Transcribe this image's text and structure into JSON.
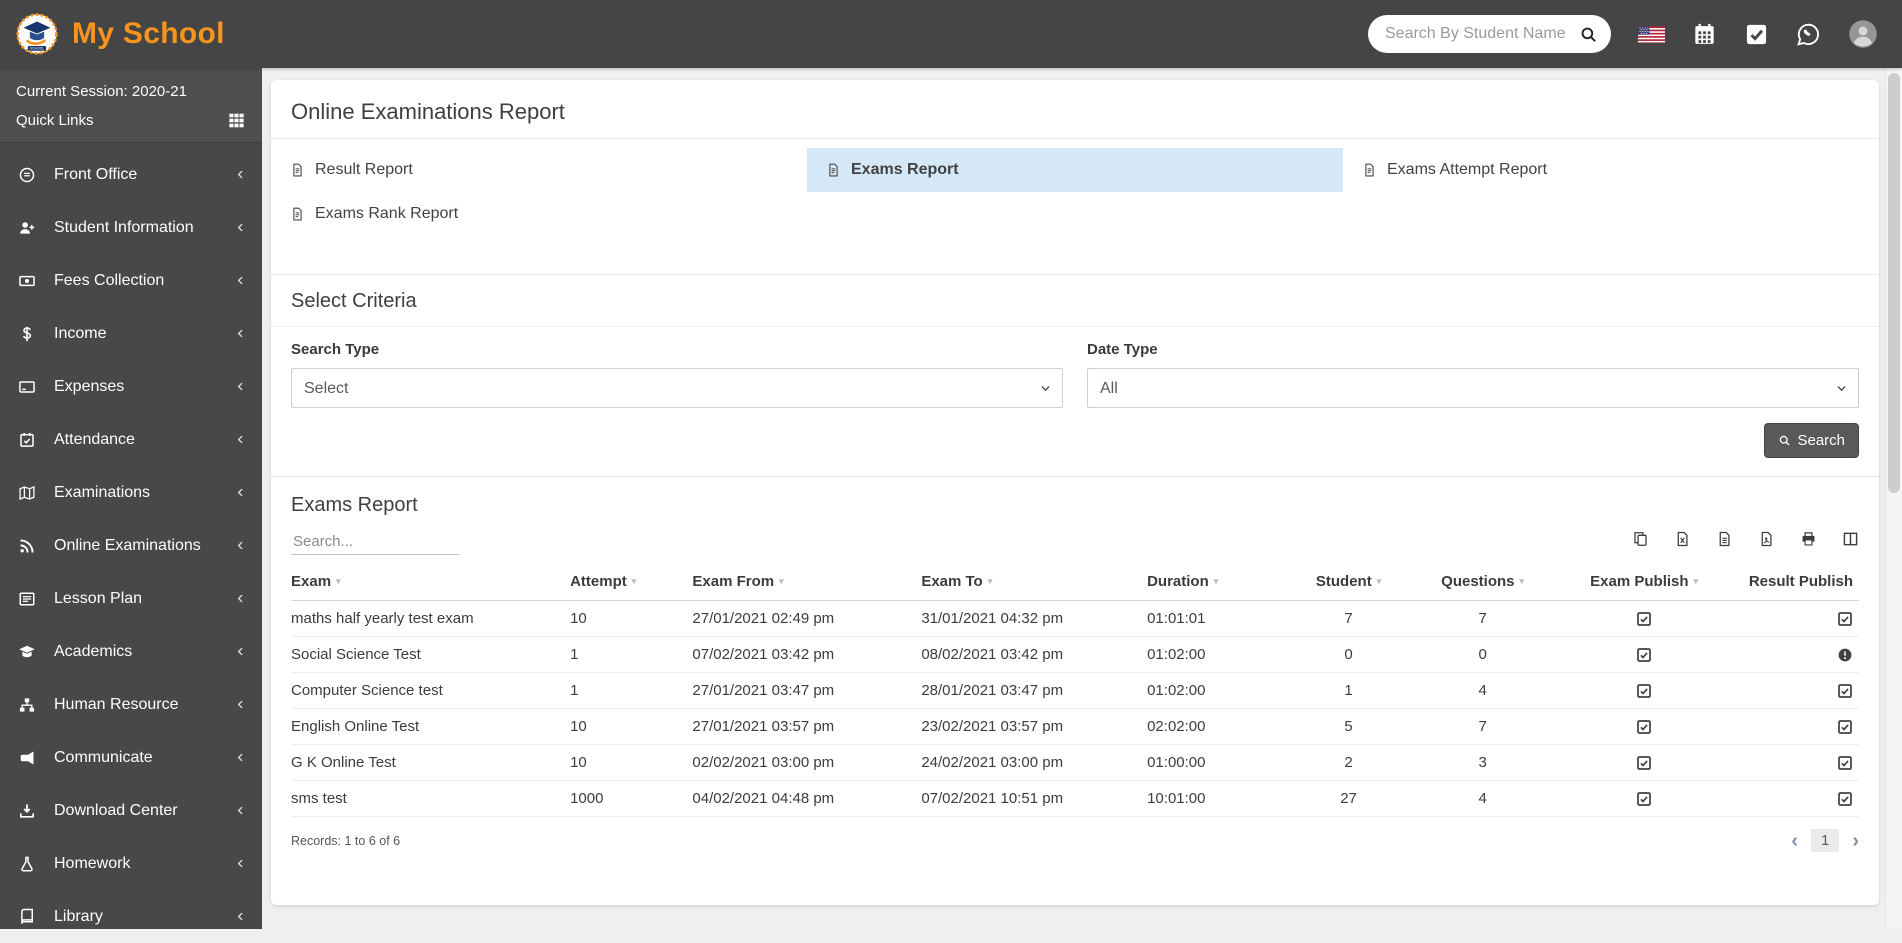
{
  "navbar": {
    "brand": "My School",
    "search_placeholder": "Search By Student Name",
    "icons": [
      "us-flag-icon",
      "calendar-icon",
      "tasks-icon",
      "whatsapp-icon",
      "user-avatar-icon"
    ]
  },
  "sidebar": {
    "session_label": "Current Session: 2020-21",
    "quick_links_label": "Quick Links",
    "items": [
      {
        "label": "Front Office",
        "icon": "front-office-icon"
      },
      {
        "label": "Student Information",
        "icon": "student-information-icon"
      },
      {
        "label": "Fees Collection",
        "icon": "fees-collection-icon"
      },
      {
        "label": "Income",
        "icon": "income-icon"
      },
      {
        "label": "Expenses",
        "icon": "expenses-icon"
      },
      {
        "label": "Attendance",
        "icon": "attendance-icon"
      },
      {
        "label": "Examinations",
        "icon": "examinations-icon"
      },
      {
        "label": "Online Examinations",
        "icon": "online-examinations-icon"
      },
      {
        "label": "Lesson Plan",
        "icon": "lesson-plan-icon"
      },
      {
        "label": "Academics",
        "icon": "academics-icon"
      },
      {
        "label": "Human Resource",
        "icon": "human-resource-icon"
      },
      {
        "label": "Communicate",
        "icon": "communicate-icon"
      },
      {
        "label": "Download Center",
        "icon": "download-center-icon"
      },
      {
        "label": "Homework",
        "icon": "homework-icon"
      },
      {
        "label": "Library",
        "icon": "library-icon"
      }
    ]
  },
  "main": {
    "page_title": "Online Examinations Report",
    "report_links": [
      {
        "label": "Result Report",
        "active": false
      },
      {
        "label": "Exams Report",
        "active": true
      },
      {
        "label": "Exams Attempt Report",
        "active": false
      },
      {
        "label": "Exams Rank Report",
        "active": false
      }
    ],
    "criteria": {
      "heading": "Select Criteria",
      "search_type_label": "Search Type",
      "search_type_value": "Select",
      "date_type_label": "Date Type",
      "date_type_value": "All",
      "search_button": "Search"
    },
    "exams_report": {
      "heading": "Exams Report",
      "search_placeholder": "Search...",
      "export_icons": [
        "copy-icon",
        "excel-icon",
        "file-lines-icon",
        "pdf-icon",
        "print-icon",
        "columns-icon"
      ],
      "columns": [
        "Exam",
        "Attempt",
        "Exam From",
        "Exam To",
        "Duration",
        "Student",
        "Questions",
        "Exam Publish",
        "Result Publish"
      ],
      "rows": [
        {
          "exam": "maths half yearly test exam",
          "attempt": "10",
          "exam_from": "27/01/2021 02:49 pm",
          "exam_to": "31/01/2021 04:32 pm",
          "duration": "01:01:01",
          "student": "7",
          "questions": "7",
          "exam_publish": "checked",
          "result_publish": "checked"
        },
        {
          "exam": "Social Science Test",
          "attempt": "1",
          "exam_from": "07/02/2021 03:42 pm",
          "exam_to": "08/02/2021 03:42 pm",
          "duration": "01:02:00",
          "student": "0",
          "questions": "0",
          "exam_publish": "checked",
          "result_publish": "alert"
        },
        {
          "exam": "Computer Science test",
          "attempt": "1",
          "exam_from": "27/01/2021 03:47 pm",
          "exam_to": "28/01/2021 03:47 pm",
          "duration": "01:02:00",
          "student": "1",
          "questions": "4",
          "exam_publish": "checked",
          "result_publish": "checked"
        },
        {
          "exam": "English Online Test",
          "attempt": "10",
          "exam_from": "27/01/2021 03:57 pm",
          "exam_to": "23/02/2021 03:57 pm",
          "duration": "02:02:00",
          "student": "5",
          "questions": "7",
          "exam_publish": "checked",
          "result_publish": "checked"
        },
        {
          "exam": "G K Online Test",
          "attempt": "10",
          "exam_from": "02/02/2021 03:00 pm",
          "exam_to": "24/02/2021 03:00 pm",
          "duration": "01:00:00",
          "student": "2",
          "questions": "3",
          "exam_publish": "checked",
          "result_publish": "checked"
        },
        {
          "exam": "sms test",
          "attempt": "1000",
          "exam_from": "04/02/2021 04:48 pm",
          "exam_to": "07/02/2021 10:51 pm",
          "duration": "10:01:00",
          "student": "27",
          "questions": "4",
          "exam_publish": "checked",
          "result_publish": "checked"
        }
      ],
      "records_text": "Records: 1 to 6 of 6",
      "pagination": {
        "prev": "‹",
        "page": "1",
        "next": "›"
      }
    }
  },
  "colors": {
    "navbar_bg": "#454545",
    "sidebar_bg": "#484848",
    "accent_orange": "#f7941d",
    "active_tab_bg": "#d5e8f7",
    "text_dark": "#3c3c3c"
  }
}
